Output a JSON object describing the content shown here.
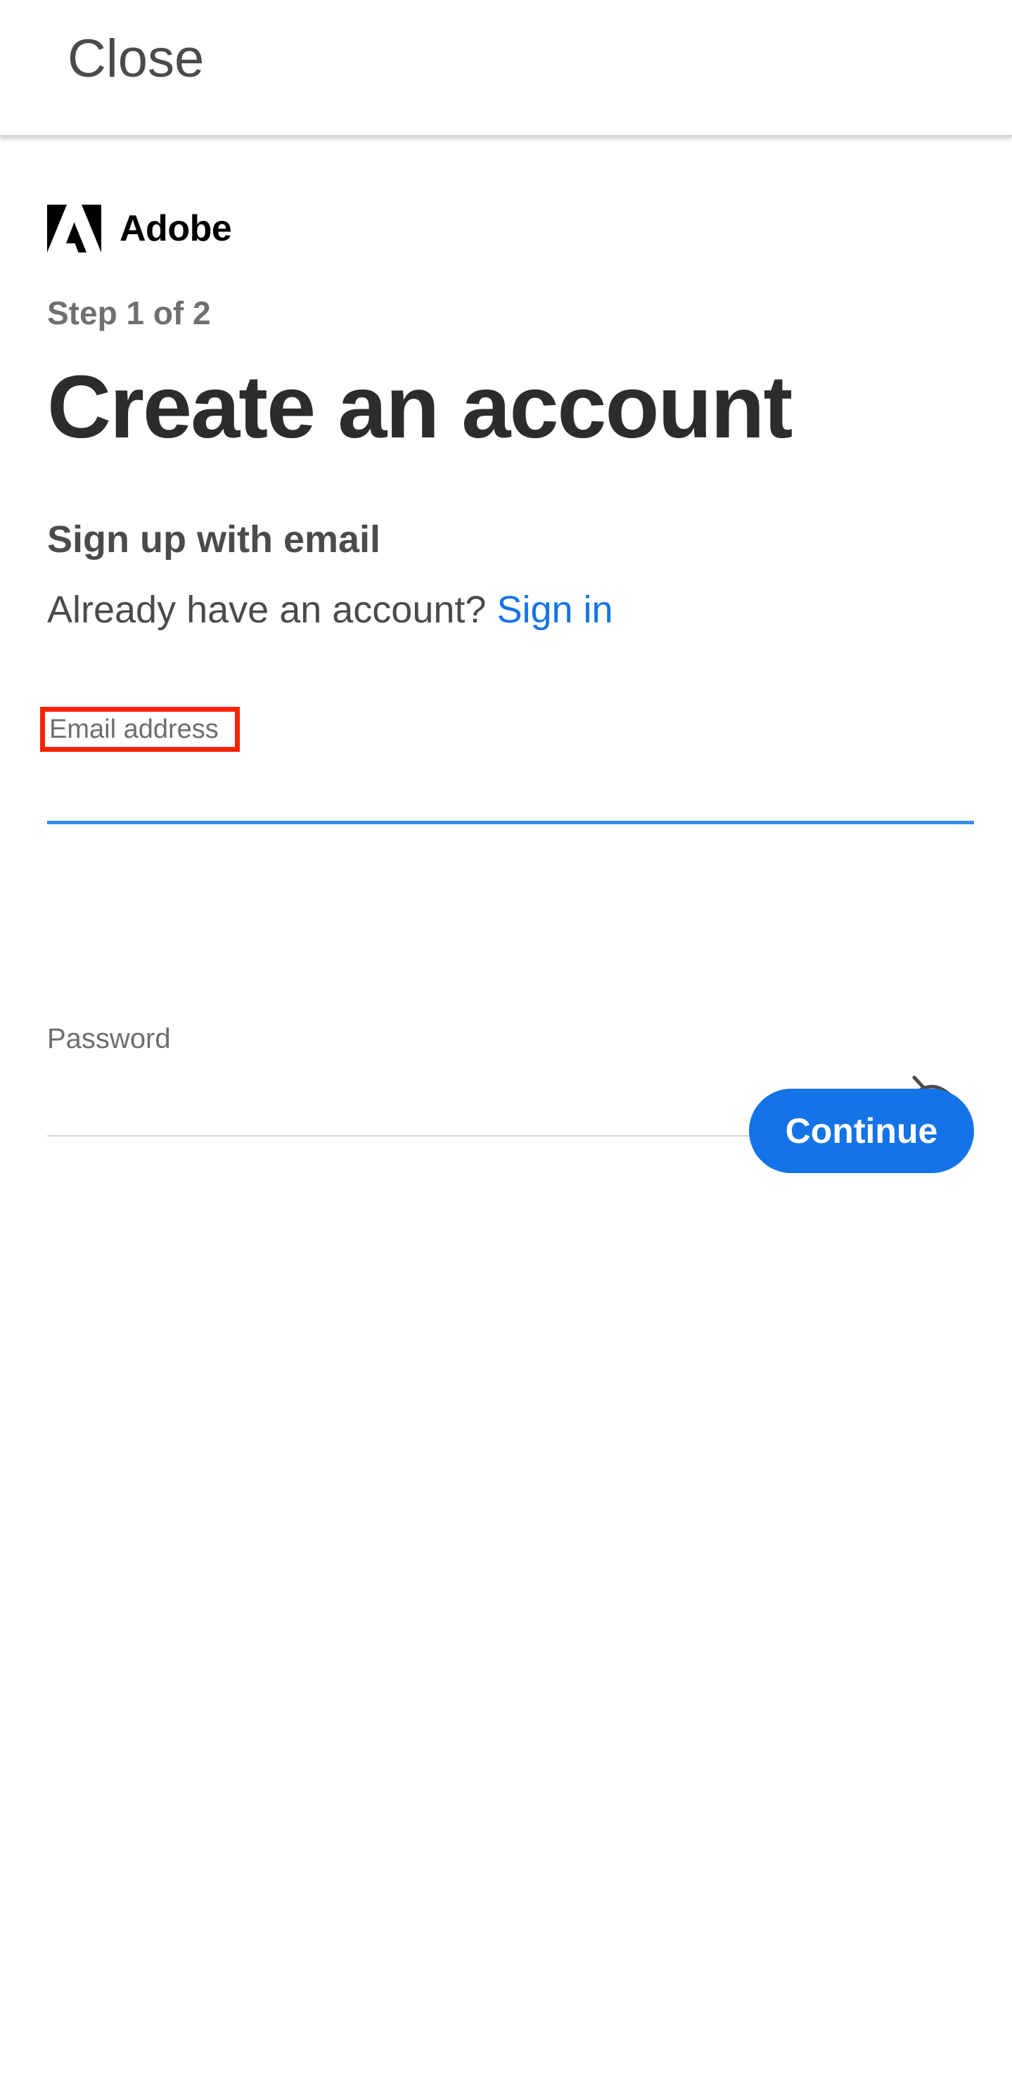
{
  "header": {
    "close_label": "Close"
  },
  "brand": {
    "name": "Adobe",
    "logo_icon": "adobe-logo-icon",
    "logo_color": "#000000"
  },
  "form": {
    "step": "Step 1 of 2",
    "title": "Create an account",
    "subhead": "Sign up with email",
    "already_text": "Already have an account?",
    "signin_label": "Sign in",
    "email_label": "Email address",
    "email_value": "",
    "password_label": "Password",
    "password_value": "",
    "password_toggle_icon": "eye-slash-icon",
    "continue_label": "Continue"
  },
  "colors": {
    "accent": "#1473e6",
    "focus_underline": "#378ef0",
    "highlight_box": "#ff2200"
  }
}
